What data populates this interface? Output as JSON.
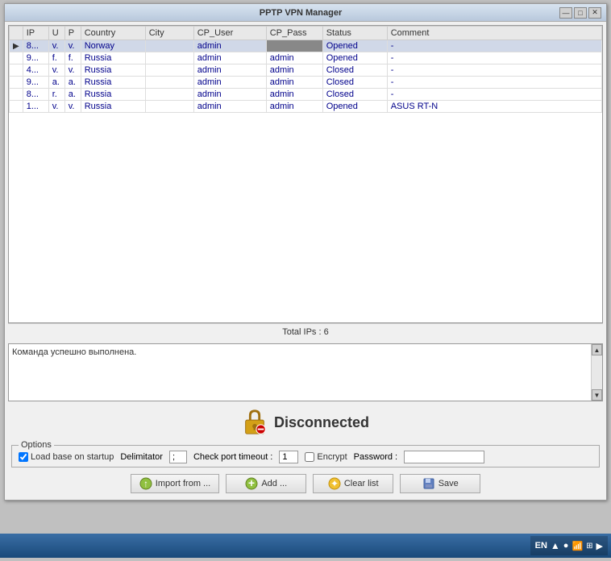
{
  "window": {
    "title": "PPTP VPN Manager",
    "minimize_label": "—",
    "maximize_label": "□",
    "close_label": "✕"
  },
  "table": {
    "columns": [
      {
        "key": "arrow",
        "label": ""
      },
      {
        "key": "ip",
        "label": "IP"
      },
      {
        "key": "u",
        "label": "U"
      },
      {
        "key": "p",
        "label": "P"
      },
      {
        "key": "country",
        "label": "Country"
      },
      {
        "key": "city",
        "label": "City"
      },
      {
        "key": "cp_user",
        "label": "CP_User"
      },
      {
        "key": "cp_pass",
        "label": "CP_Pass"
      },
      {
        "key": "status",
        "label": "Status"
      },
      {
        "key": "comment",
        "label": "Comment"
      }
    ],
    "rows": [
      {
        "arrow": "▶",
        "ip": "8...",
        "u": "v.",
        "p": "v.",
        "country": "Norway",
        "city": "",
        "cp_user": "admin",
        "cp_pass": "••••",
        "status": "Opened",
        "comment": "-",
        "selected": true,
        "pass_hidden": true
      },
      {
        "arrow": "",
        "ip": "9...",
        "u": "f.",
        "p": "f.",
        "country": "Russia",
        "city": "",
        "cp_user": "admin",
        "cp_pass": "admin",
        "status": "Opened",
        "comment": "-",
        "selected": false,
        "pass_hidden": false
      },
      {
        "arrow": "",
        "ip": "4...",
        "u": "v.",
        "p": "v.",
        "country": "Russia",
        "city": "",
        "cp_user": "admin",
        "cp_pass": "admin",
        "status": "Closed",
        "comment": "-",
        "selected": false,
        "pass_hidden": false
      },
      {
        "arrow": "",
        "ip": "9...",
        "u": "a.",
        "p": "a.",
        "country": "Russia",
        "city": "",
        "cp_user": "admin",
        "cp_pass": "admin",
        "status": "Closed",
        "comment": "-",
        "selected": false,
        "pass_hidden": false
      },
      {
        "arrow": "",
        "ip": "8...",
        "u": "r.",
        "p": "a.",
        "country": "Russia",
        "city": "",
        "cp_user": "admin",
        "cp_pass": "admin",
        "status": "Closed",
        "comment": "-",
        "selected": false,
        "pass_hidden": false
      },
      {
        "arrow": "",
        "ip": "1...",
        "u": "v.",
        "p": "v.",
        "country": "Russia",
        "city": "",
        "cp_user": "admin",
        "cp_pass": "admin",
        "status": "Opened",
        "comment": "ASUS RT-N",
        "selected": false,
        "pass_hidden": false
      }
    ],
    "total_ips_label": "Total IPs : 6"
  },
  "log": {
    "text": "Команда успешно выполнена."
  },
  "status": {
    "text": "Disconnected"
  },
  "options": {
    "group_label": "Options",
    "load_base_label": "Load base on startup",
    "load_base_checked": true,
    "delimiter_label": "Delimitator",
    "delimiter_value": ";",
    "check_port_label": "Check port timeout :",
    "check_port_value": "1",
    "encrypt_label": "Encrypt",
    "encrypt_checked": false,
    "password_label": "Password :",
    "password_value": ""
  },
  "buttons": {
    "import_label": "Import from ...",
    "add_label": "Add ...",
    "clear_label": "Clear list",
    "save_label": "Save"
  },
  "taskbar": {
    "lang": "EN"
  }
}
